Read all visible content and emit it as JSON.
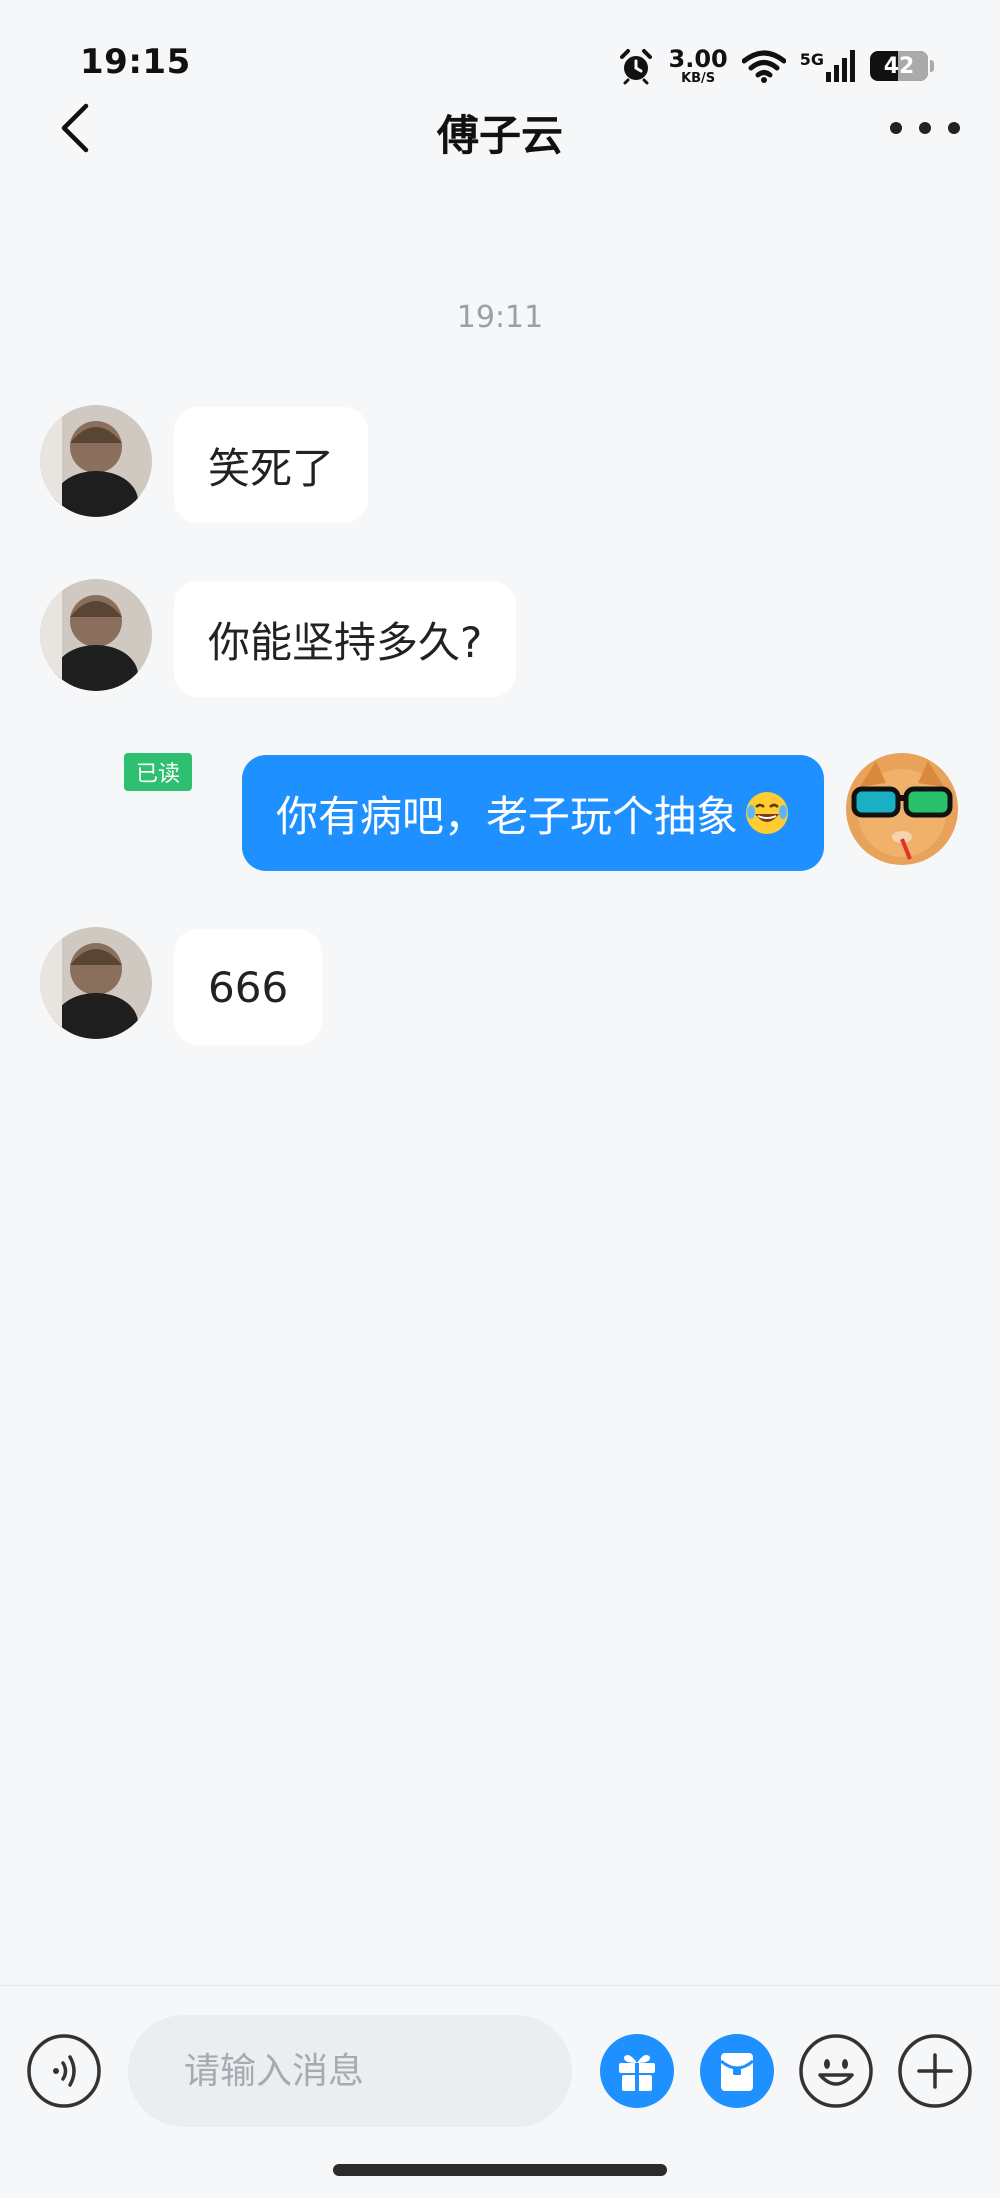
{
  "status_bar": {
    "time": "19:15",
    "net_speed_value": "3.00",
    "net_speed_unit": "KB/S",
    "network_type": "5G",
    "battery": "42",
    "icons": [
      "alarm-icon",
      "wifi-icon",
      "signal-icon",
      "battery-icon"
    ]
  },
  "header": {
    "title": "傅子云",
    "back_icon": "chevron-left-icon",
    "more_icon": "more-dots-icon"
  },
  "chat": {
    "timestamp": "19:11",
    "messages": [
      {
        "side": "left",
        "text": "笑死了"
      },
      {
        "side": "left",
        "text": "你能坚持多久?"
      },
      {
        "side": "right",
        "text": "你有病吧，老子玩个抽象",
        "emoji": "laughing-tears-emoji",
        "read_label": "已读"
      },
      {
        "side": "left",
        "text": "666"
      }
    ]
  },
  "input_bar": {
    "placeholder": "请输入消息",
    "value": "",
    "buttons": [
      "voice-icon",
      "gift-icon",
      "red-packet-icon",
      "emoji-icon",
      "plus-icon"
    ]
  },
  "colors": {
    "background": "#f6f7f9",
    "outgoing_bubble": "#1e90ff",
    "incoming_bubble": "#ffffff",
    "read_badge": "#2fbf71",
    "accent_button": "#1e90ff"
  }
}
